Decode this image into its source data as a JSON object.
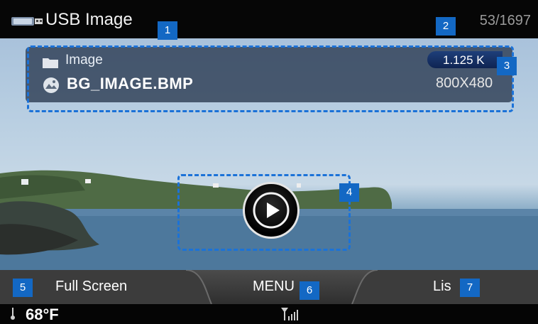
{
  "header": {
    "title": "USB Image",
    "counter": "53/1697",
    "icon": "usb-icon"
  },
  "file_info": {
    "folder_name": "Image",
    "folder_icon": "folder-icon",
    "file_name": "BG_IMAGE.BMP",
    "file_icon": "image-file-icon",
    "file_size": "1.125 K",
    "resolution": "800X480"
  },
  "controls": {
    "play_icon": "play-icon"
  },
  "menu": {
    "full_screen_label": "Full Screen",
    "menu_label": "MENU",
    "list_label": "Lis"
  },
  "status": {
    "temperature": "68°F",
    "signal_icon": "signal-icon"
  },
  "callouts": [
    "1",
    "2",
    "3",
    "4",
    "5",
    "6",
    "7"
  ],
  "colors": {
    "callout": "#1368c4",
    "highlight_border": "#1b72d8"
  }
}
